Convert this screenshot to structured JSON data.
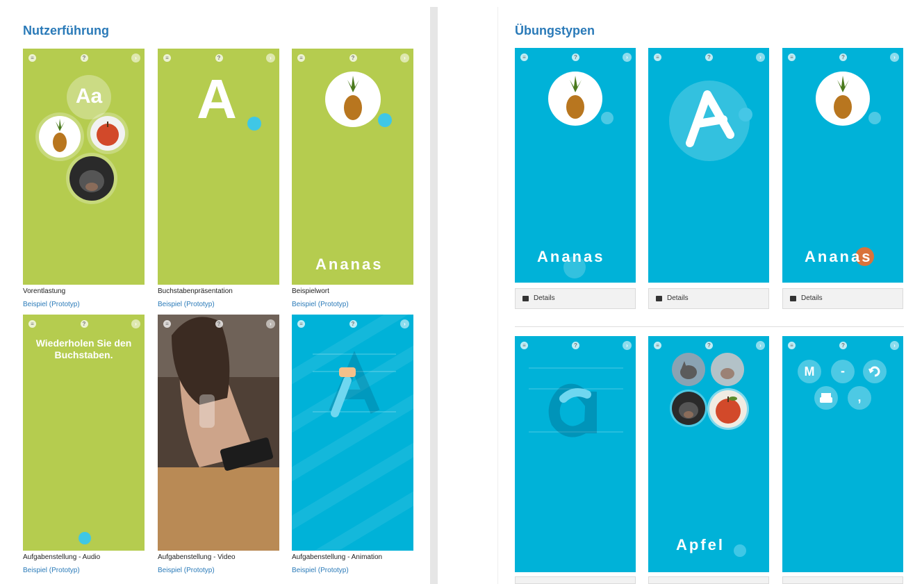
{
  "sections": {
    "left_title": "Nutzerführung",
    "right_title": "Übungstypen"
  },
  "left_cards": [
    {
      "caption": "Vorentlastung",
      "link": "Beispiel (Prototyp)"
    },
    {
      "caption": "Buchstabenpräsentation",
      "link": "Beispiel (Prototyp)"
    },
    {
      "caption": "Beispielwort",
      "link": "Beispiel (Prototyp)"
    },
    {
      "caption": "Aufgabenstellung - Audio",
      "link": "Beispiel (Prototyp)"
    },
    {
      "caption": "Aufgabenstellung - Video",
      "link": "Beispiel (Prototyp)"
    },
    {
      "caption": "Aufgabenstellung - Animation",
      "link": "Beispiel (Prototyp)"
    }
  ],
  "right_cards": [
    {
      "details": "Details"
    },
    {
      "details": "Details"
    },
    {
      "details": "Details"
    }
  ],
  "phone_text": {
    "aa": "Aa",
    "big_a": "A",
    "word_ananas": "Ananas",
    "instruction": "Wiederholen Sie den Buchstaben.",
    "word_apfel": "Apfel",
    "letter_m": "M",
    "letter_dash": "-",
    "letter_comma": ","
  },
  "colors": {
    "green": "#b5cc4f",
    "blue": "#00b2d8",
    "title": "#2a7ab8"
  }
}
